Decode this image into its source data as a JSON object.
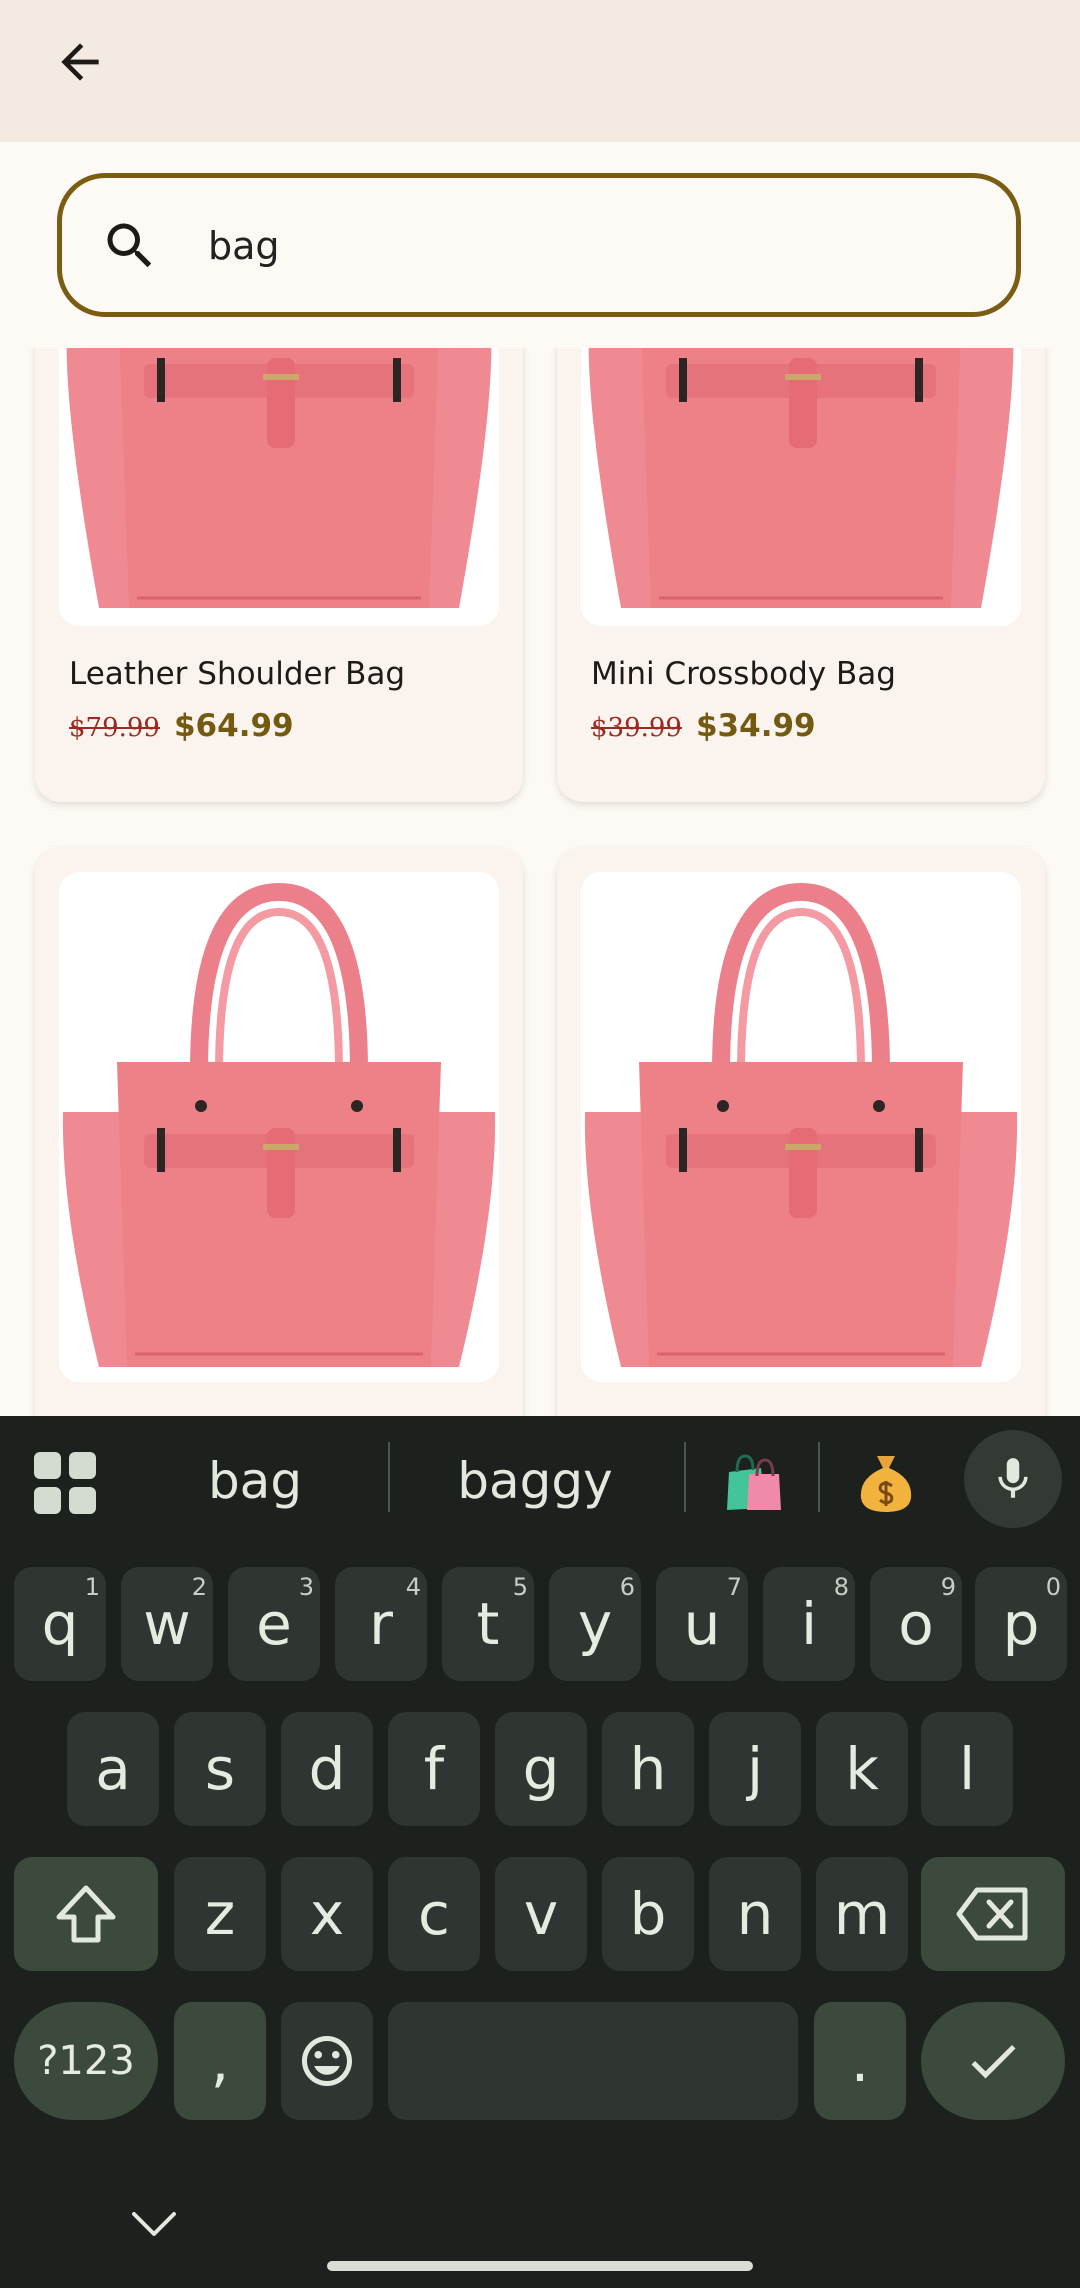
{
  "header": {
    "back_icon": "arrow-back-icon"
  },
  "search": {
    "value": "bag",
    "placeholder": "",
    "icon": "search-icon",
    "border_color": "#7a5c12"
  },
  "products": [
    {
      "name": "Leather Shoulder Bag",
      "old_price": "$79.99",
      "price": "$64.99"
    },
    {
      "name": "Mini Crossbody Bag",
      "old_price": "$39.99",
      "price": "$34.99"
    },
    {
      "name": "",
      "old_price": "",
      "price": ""
    },
    {
      "name": "",
      "old_price": "",
      "price": ""
    }
  ],
  "colors": {
    "price": "#735a10",
    "old_price": "#9b2a23",
    "bag": "#f08a92",
    "keyboard_bg": "#1c211d"
  },
  "keyboard": {
    "suggestions": [
      "bag",
      "baggy"
    ],
    "emoji_suggestions": [
      "shopping-bags-emoji",
      "money-bag-emoji"
    ],
    "row1": [
      {
        "k": "q",
        "h": "1"
      },
      {
        "k": "w",
        "h": "2"
      },
      {
        "k": "e",
        "h": "3"
      },
      {
        "k": "r",
        "h": "4"
      },
      {
        "k": "t",
        "h": "5"
      },
      {
        "k": "y",
        "h": "6"
      },
      {
        "k": "u",
        "h": "7"
      },
      {
        "k": "i",
        "h": "8"
      },
      {
        "k": "o",
        "h": "9"
      },
      {
        "k": "p",
        "h": "0"
      }
    ],
    "row2": [
      "a",
      "s",
      "d",
      "f",
      "g",
      "h",
      "j",
      "k",
      "l"
    ],
    "row3": [
      "z",
      "x",
      "c",
      "v",
      "b",
      "n",
      "m"
    ],
    "symbols_label": "?123",
    "comma": ",",
    "period": "."
  }
}
